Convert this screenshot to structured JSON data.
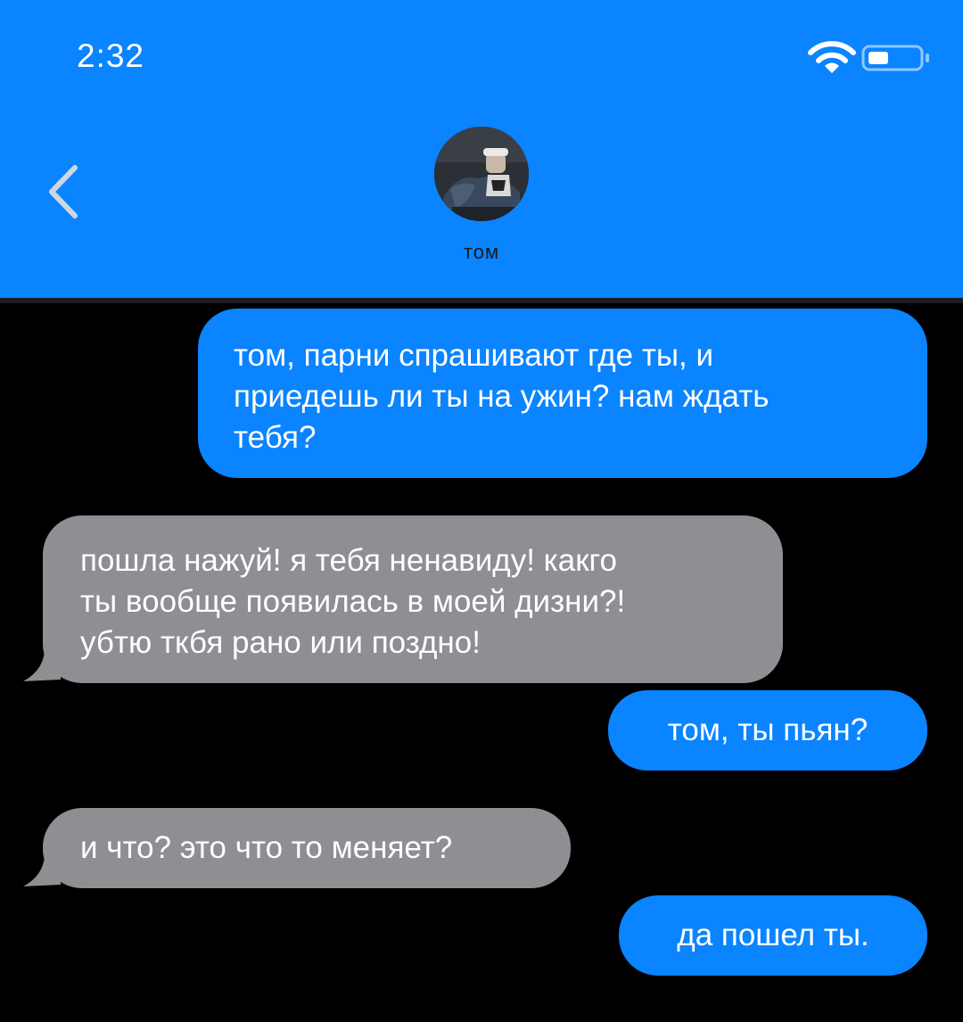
{
  "status_bar": {
    "time": "2:32",
    "wifi_icon": "wifi-icon",
    "battery_icon": "battery-icon"
  },
  "colors": {
    "header": "#0a84ff",
    "outgoing_bubble": "#0a84ff",
    "incoming_bubble": "#8e8e93",
    "background": "#000000"
  },
  "header": {
    "back_icon": "chevron-left-icon",
    "contact_name": "том"
  },
  "messages": [
    {
      "direction": "outgoing",
      "text": "том, парни спрашивают где ты, и\nприедешь ли ты на ужин? нам ждать\nтебя?"
    },
    {
      "direction": "incoming",
      "text": "пошла нажуй! я тебя ненавиду! какго\nты вообще появилась в моей дизни?!\nубтю ткбя рано или поздно!"
    },
    {
      "direction": "outgoing",
      "text": "том, ты пьян?"
    },
    {
      "direction": "incoming",
      "text": "и что? это что то меняет?"
    },
    {
      "direction": "outgoing",
      "text": "да пошел ты."
    }
  ]
}
